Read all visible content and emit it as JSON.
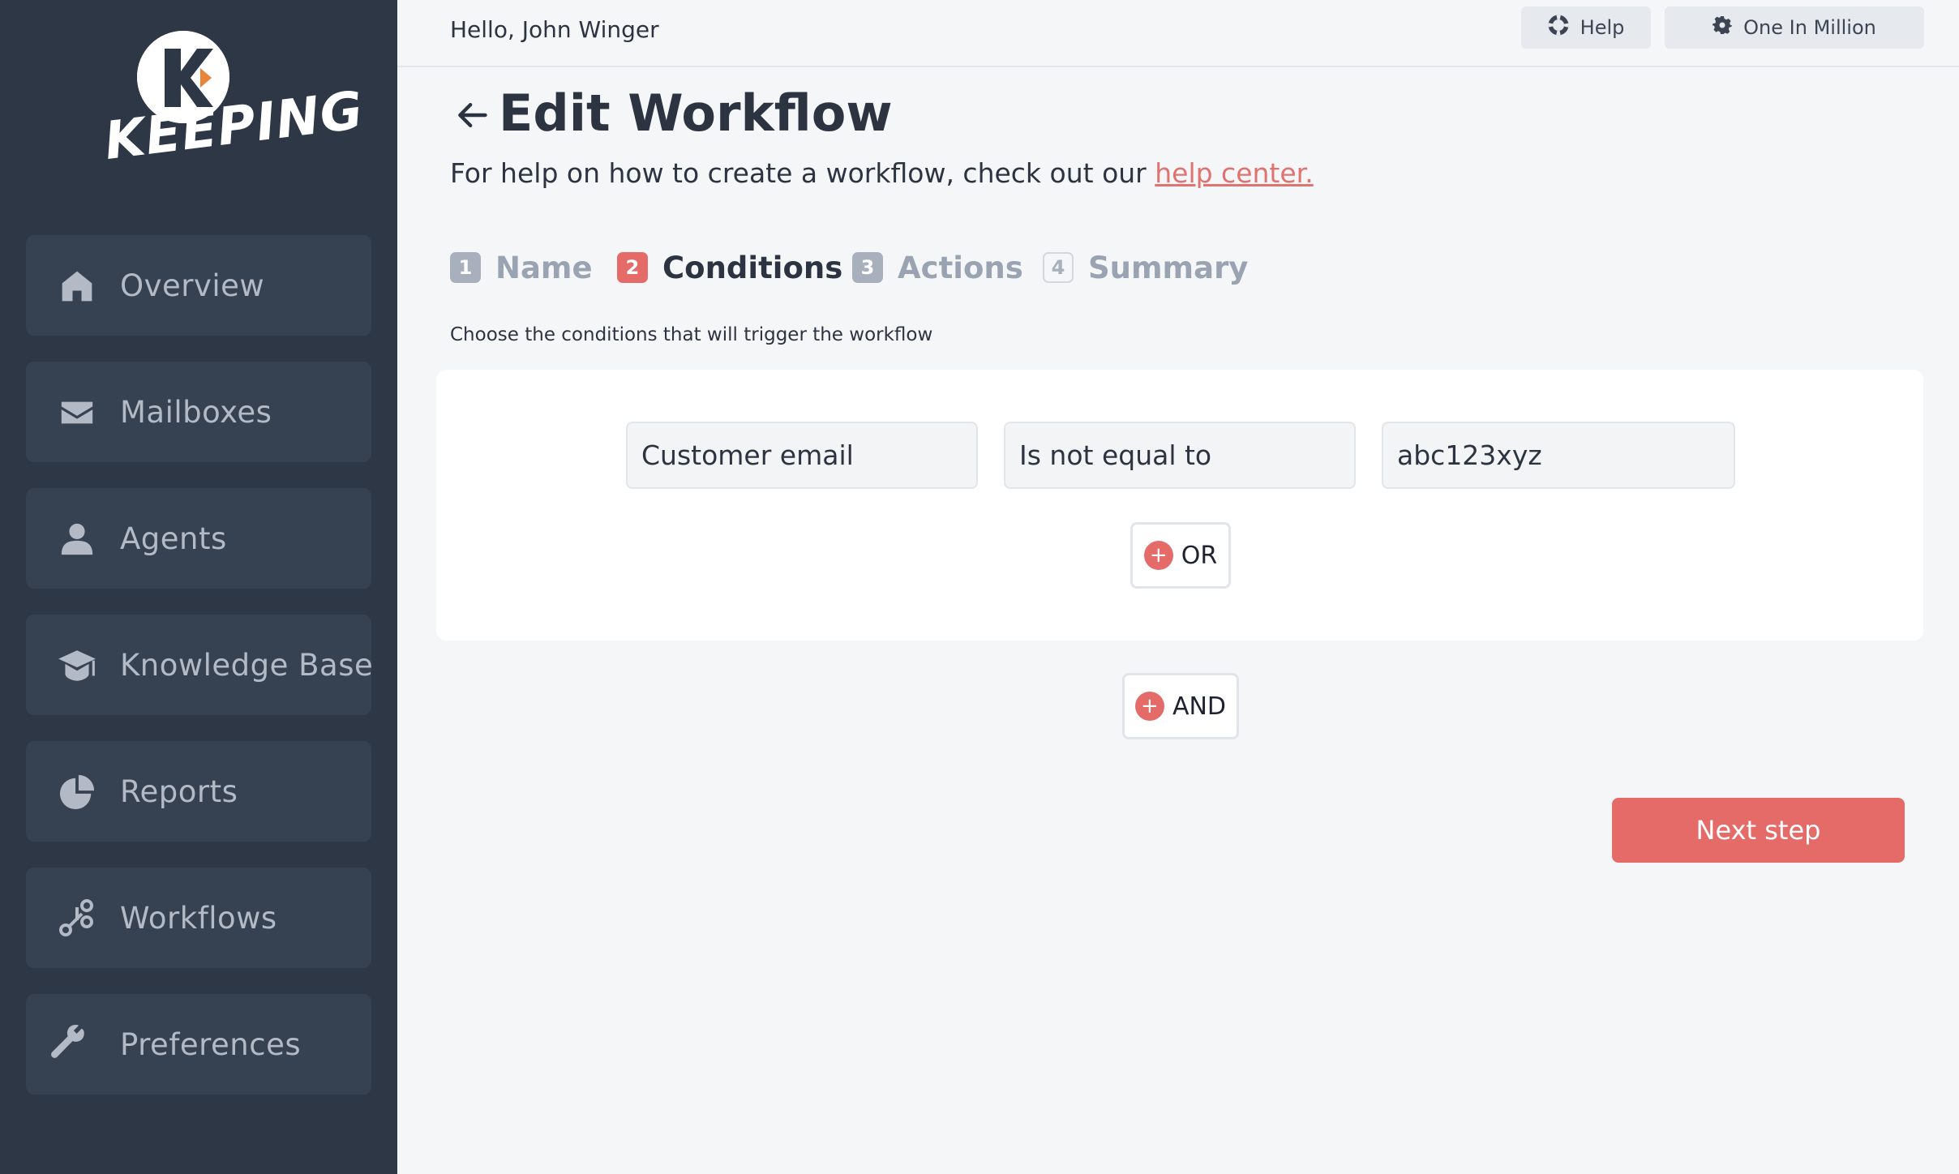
{
  "brand": {
    "name": "KEEPING",
    "accent": "#e56b69"
  },
  "sidebar": {
    "items": [
      {
        "label": "Overview",
        "icon": "home-icon"
      },
      {
        "label": "Mailboxes",
        "icon": "envelope-icon"
      },
      {
        "label": "Agents",
        "icon": "user-icon"
      },
      {
        "label": "Knowledge Base",
        "icon": "graduation-cap-icon"
      },
      {
        "label": "Reports",
        "icon": "pie-chart-icon"
      },
      {
        "label": "Workflows",
        "icon": "workflow-icon"
      },
      {
        "label": "Preferences",
        "icon": "wrench-icon"
      }
    ]
  },
  "header": {
    "greeting": "Hello, John Winger",
    "help_label": "Help",
    "account_label": "One In Million"
  },
  "page": {
    "title": "Edit Workflow",
    "help_prefix": "For help on how to create a workflow, check out our ",
    "help_link": "help center."
  },
  "steps": [
    {
      "num": "1",
      "label": "Name"
    },
    {
      "num": "2",
      "label": "Conditions"
    },
    {
      "num": "3",
      "label": "Actions"
    },
    {
      "num": "4",
      "label": "Summary"
    }
  ],
  "conditions": {
    "intro": "Choose the conditions that will trigger the workflow",
    "field": "Customer email",
    "operator": "Is not equal to",
    "value": "abc123xyz",
    "or_label": "OR",
    "and_label": "AND"
  },
  "next_label": "Next step"
}
